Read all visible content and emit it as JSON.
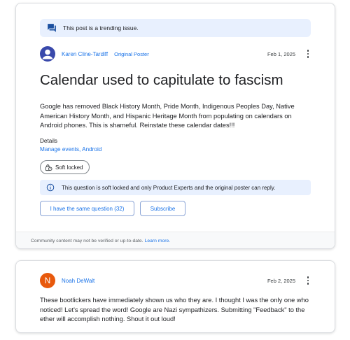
{
  "post": {
    "trending_banner": "This post is a trending issue.",
    "author": "Karen Cline-Tardiff",
    "author_tag": "Original Poster",
    "date": "Feb 1, 2025",
    "title": "Calendar used to capitulate to fascism",
    "body": "Google has removed Black History Month, Pride Month, Indigenous Peoples Day, Native American History Month, and Hispanic Heritage Month from populating on calendars on Android phones. This is shameful. Reinstate these calendar dates!!!",
    "details_label": "Details",
    "details_tags": [
      "Manage events",
      "Android"
    ],
    "details_separator": ", ",
    "soft_locked_chip": "Soft locked",
    "soft_locked_notice": "This question is soft locked and only Product Experts and the original poster can reply.",
    "same_question_button": "I have the same question (32)",
    "subscribe_button": "Subscribe",
    "footer_text": "Community content may not be verified or up-to-date.",
    "footer_link": "Learn more."
  },
  "reply": {
    "avatar_initial": "N",
    "author": "Noah DeWalt",
    "date": "Feb 2, 2025",
    "body": "These bootlickers have immediately shown us who they are. I thought I was the only one who noticed! Let's spread the word! Google are Nazi sympathizers. Submitting \"Feedback\" to the ether will accomplish nothing. Shout it out loud!"
  },
  "icons": {
    "trending": "forum-icon",
    "author_avatar": "person-avatar-icon",
    "more": "more-vert-icon",
    "lock": "lock-clock-icon",
    "info": "info-icon"
  },
  "colors": {
    "accent": "#1a73e8",
    "banner_bg": "#e8f0fe",
    "avatar_blue": "#3949ab",
    "avatar_orange": "#e8590c"
  }
}
